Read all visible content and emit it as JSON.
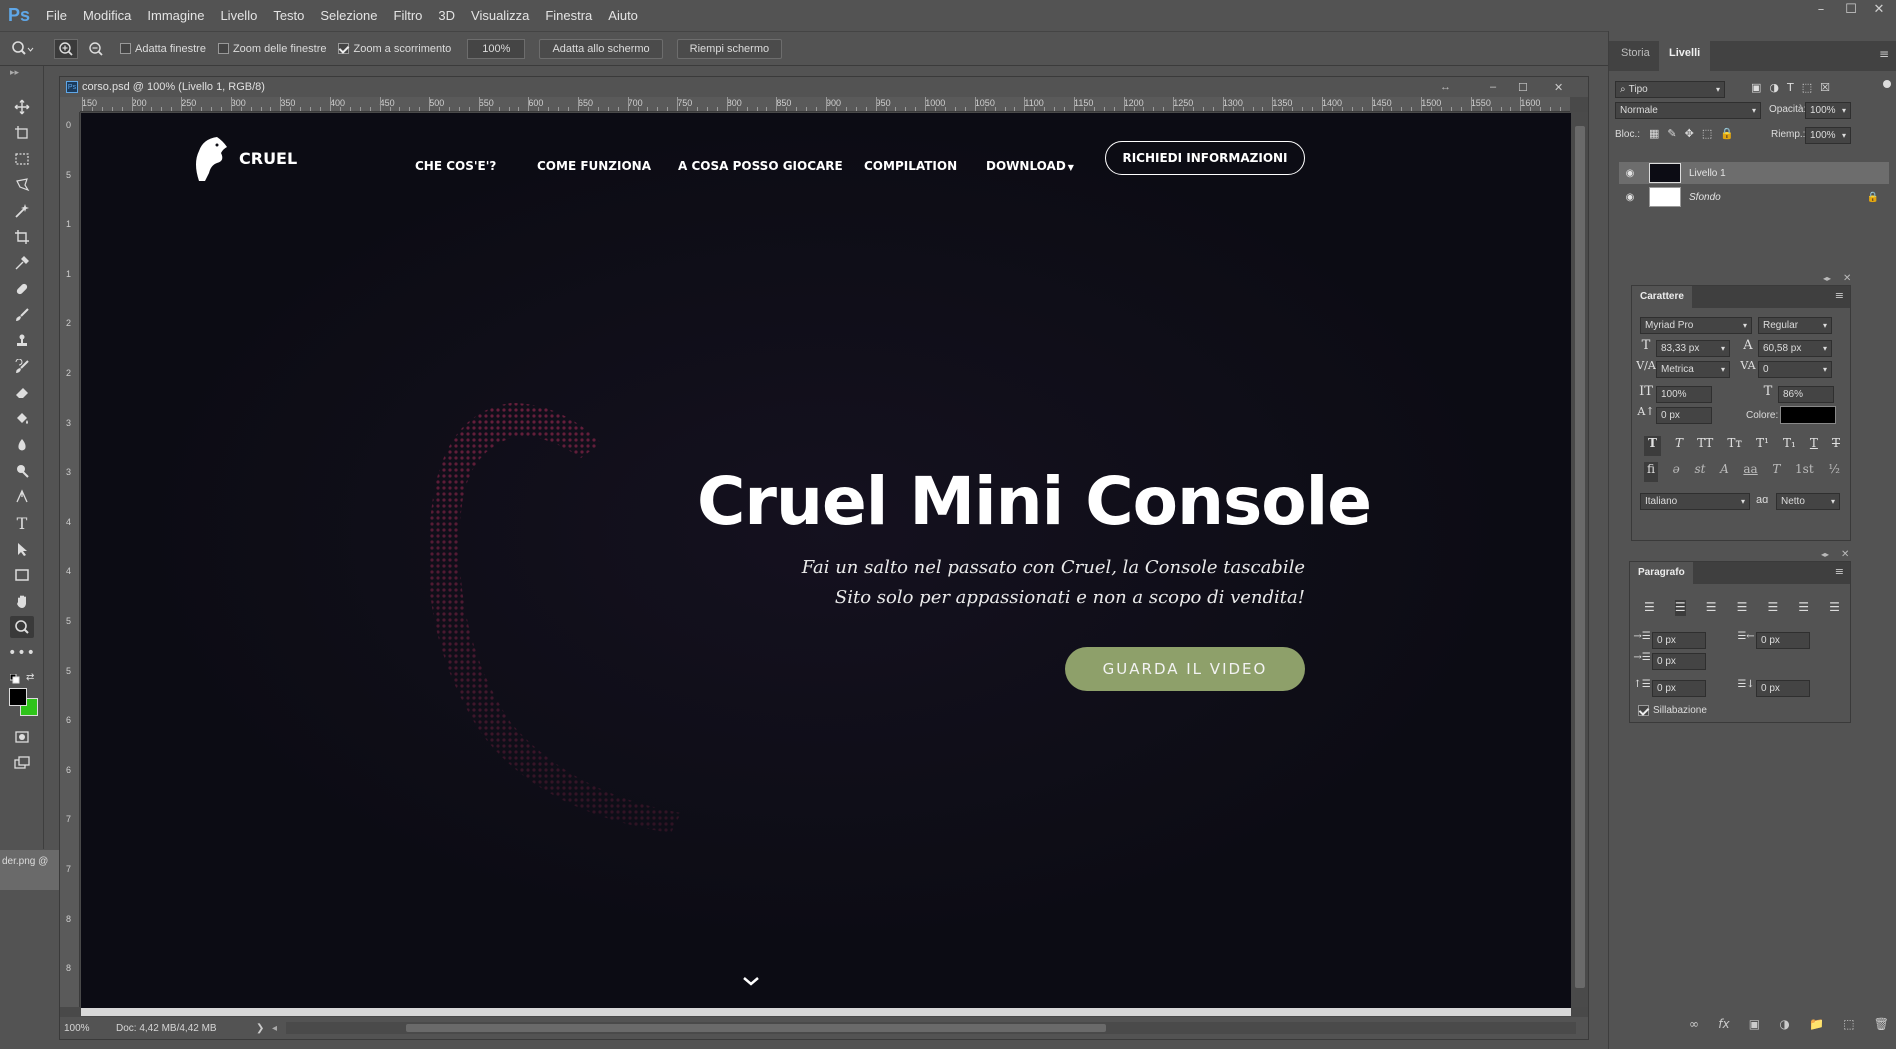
{
  "app": {
    "logo": "Ps"
  },
  "menu": [
    "File",
    "Modifica",
    "Immagine",
    "Livello",
    "Testo",
    "Selezione",
    "Filtro",
    "3D",
    "Visualizza",
    "Finestra",
    "Aiuto"
  ],
  "options": {
    "adatta_finestre": "Adatta finestre",
    "zoom_finestre": "Zoom delle finestre",
    "zoom_scorrimento": "Zoom a scorrimento",
    "zoom_value": "100%",
    "adatta_schermo": "Adatta allo schermo",
    "riempi_schermo": "Riempi schermo"
  },
  "document": {
    "title": "corso.psd @ 100% (Livello 1, RGB/8)",
    "zoom_status": "100%",
    "doc_size": "Doc: 4,42 MB/4,42 MB",
    "side_tab": "der.png @"
  },
  "ruler": {
    "h": [
      "150",
      "200",
      "250",
      "300",
      "350",
      "400",
      "450",
      "500",
      "550",
      "600",
      "650",
      "700",
      "750",
      "800",
      "850",
      "900",
      "950",
      "1000",
      "1050",
      "1100",
      "1150",
      "1200",
      "1250",
      "1300",
      "1350",
      "1400",
      "1450",
      "1500",
      "1550",
      "1600"
    ],
    "v": [
      "0",
      "5",
      "1",
      "1",
      "2",
      "2",
      "3",
      "3",
      "4",
      "4",
      "5",
      "5",
      "6",
      "6",
      "7",
      "7",
      "8",
      "8"
    ]
  },
  "site": {
    "brand": "CRUEL",
    "nav": [
      "CHE COS'E'?",
      "COME FUNZIONA",
      "A COSA POSSO GIOCARE",
      "COMPILATION",
      "DOWNLOAD"
    ],
    "cta": "RICHIEDI INFORMAZIONI",
    "hero_title": "Cruel Mini Console",
    "hero_line1": "Fai un salto nel passato con Cruel, la Console tascabile",
    "hero_line2": "Sito solo per appassionati  e non a scopo di vendita!",
    "video_button": "GUARDA IL VIDEO",
    "colors": {
      "bg": "#0c0c14",
      "accent": "#8ea06a"
    }
  },
  "layers_panel": {
    "tabs": [
      "Storia",
      "Livelli"
    ],
    "filter": "Tipo",
    "blend": "Normale",
    "opacity_label": "Opacità:",
    "opacity": "100%",
    "lock_label": "Bloc.:",
    "fill_label": "Riemp.:",
    "fill": "100%",
    "layers": [
      {
        "name": "Livello 1"
      },
      {
        "name": "Sfondo"
      }
    ]
  },
  "character_panel": {
    "title": "Carattere",
    "font": "Myriad Pro",
    "style": "Regular",
    "size": "83,33 px",
    "leading": "60,58 px",
    "kerning": "Metrica",
    "tracking": "0",
    "vscale": "100%",
    "hscale": "86%",
    "baseline": "0 px",
    "color_label": "Colore:",
    "language": "Italiano",
    "antialias": "Netto",
    "aa_label": "aɑ"
  },
  "paragraph_panel": {
    "title": "Paragrafo",
    "indent_left": "0 px",
    "indent_right": "0 px",
    "indent_first": "0 px",
    "space_before": "0 px",
    "space_after": "0 px",
    "hyphenation": "Sillabazione"
  }
}
